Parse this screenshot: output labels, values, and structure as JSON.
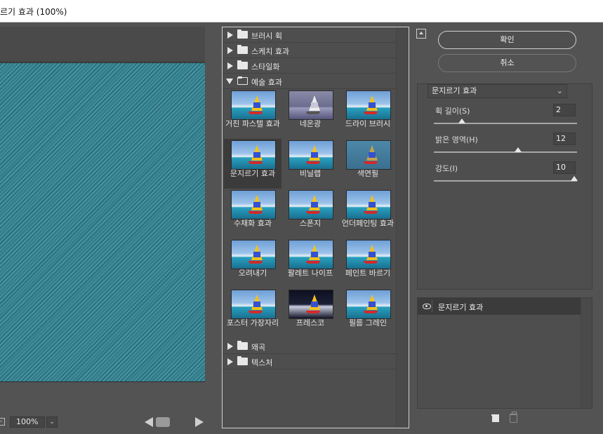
{
  "window": {
    "title": "르기 효과 (100%)"
  },
  "preview": {
    "zoom_minus": "-",
    "zoom": "100%",
    "zoom_drop": "⌄"
  },
  "gallery": {
    "folders_top": [
      {
        "label": "브러시 획",
        "expanded": false
      },
      {
        "label": "스케치 효과",
        "expanded": false
      },
      {
        "label": "스타일화",
        "expanded": false
      },
      {
        "label": "예술 효과",
        "expanded": true
      }
    ],
    "filters": [
      {
        "label": "거친 파스텔 효과",
        "style": "normal"
      },
      {
        "label": "네온광",
        "style": "dark"
      },
      {
        "label": "드라이 브러시",
        "style": "normal"
      },
      {
        "label": "문지르기 효과",
        "style": "normal",
        "selected": true
      },
      {
        "label": "비닐랩",
        "style": "normal"
      },
      {
        "label": "색연필",
        "style": "mountain"
      },
      {
        "label": "수채화 효과",
        "style": "normal"
      },
      {
        "label": "스폰지",
        "style": "normal"
      },
      {
        "label": "언더페인팅 효과",
        "style": "normal"
      },
      {
        "label": "오려내기",
        "style": "normal"
      },
      {
        "label": "팔레트 나이프",
        "style": "normal"
      },
      {
        "label": "페인트 바르기",
        "style": "normal"
      },
      {
        "label": "포스터 가장자리",
        "style": "normal"
      },
      {
        "label": "프레스코",
        "style": "night"
      },
      {
        "label": "필름 그레인",
        "style": "normal"
      }
    ],
    "folders_bottom": [
      {
        "label": "왜곡",
        "expanded": false
      },
      {
        "label": "텍스처",
        "expanded": false
      }
    ]
  },
  "buttons": {
    "ok": "확인",
    "cancel": "취소"
  },
  "settings": {
    "filter_select": "문지르기 효과",
    "params": [
      {
        "label": "획 길이(S)",
        "value": "2",
        "level": 0.2
      },
      {
        "label": "밝은 영역(H)",
        "value": "12",
        "level": 0.6
      },
      {
        "label": "강도(I)",
        "value": "10",
        "level": 1.0
      }
    ]
  },
  "layers": {
    "items": [
      {
        "name": "문지르기 효과"
      }
    ]
  }
}
